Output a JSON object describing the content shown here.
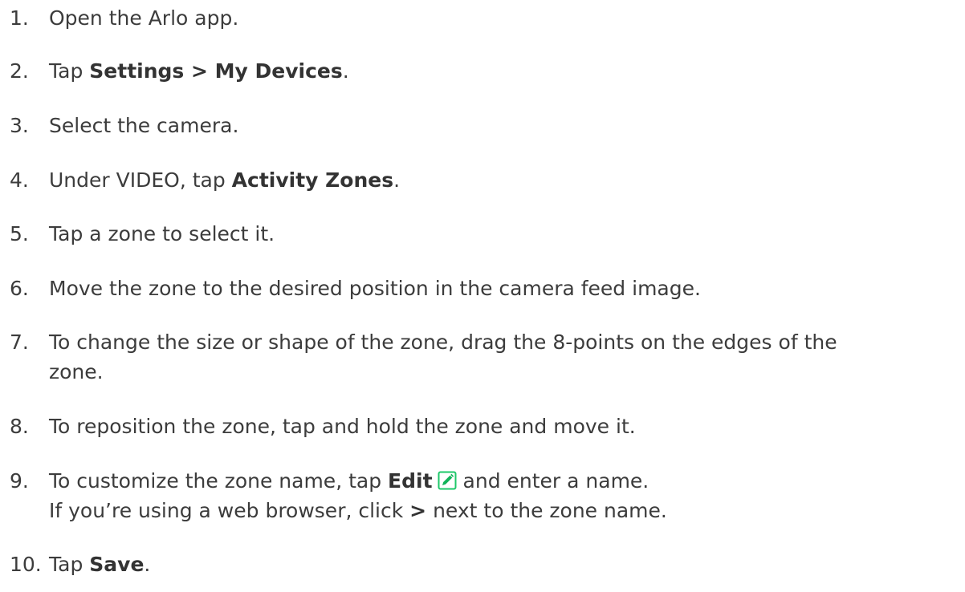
{
  "steps": [
    {
      "num": "1.",
      "text": "Open the Arlo app."
    },
    {
      "num": "2.",
      "pre": "Tap ",
      "bold": "Settings > My Devices",
      "post": "."
    },
    {
      "num": "3.",
      "text": "Select the camera."
    },
    {
      "num": "4.",
      "pre": "Under VIDEO, tap ",
      "bold": "Activity Zones",
      "post": "."
    },
    {
      "num": "5.",
      "text": "Tap a zone to select it."
    },
    {
      "num": "6.",
      "text": "Move the zone to the desired position in the camera feed image."
    },
    {
      "num": "7.",
      "line1": "To change the size or shape of the zone, drag the 8-points on the edges of the",
      "line2": "zone."
    },
    {
      "num": "8.",
      "text": "To reposition the zone, tap and hold the zone and move it."
    },
    {
      "num": "9.",
      "pre": "To customize the zone name, tap ",
      "bold": "Edit",
      "post": "and enter a name.",
      "line2_pre": "If you’re using a web browser, click ",
      "line2_bold": ">",
      "line2_post": " next to the zone name."
    },
    {
      "num": "10.",
      "pre": "Tap ",
      "bold": "Save",
      "post": "."
    }
  ],
  "icons": {
    "edit": "edit-pencil-icon"
  },
  "colors": {
    "text": "#3c3c3c",
    "edit_icon_border": "#1ec86a",
    "edit_icon_pencil": "#12b35a"
  }
}
